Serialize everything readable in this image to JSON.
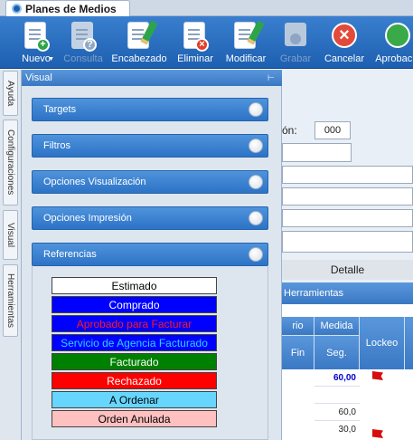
{
  "app_tab": {
    "title": "Planes de Medios"
  },
  "toolbar": {
    "nuevo": "Nuevo",
    "consulta": "Consulta",
    "encabezado": "Encabezado",
    "eliminar": "Eliminar",
    "modificar": "Modificar",
    "grabar": "Grabar",
    "cancelar": "Cancelar",
    "aprobacion": "Aprobació"
  },
  "side_tabs": [
    "Ayuda",
    "Configuraciones",
    "Visual",
    "Herramientas"
  ],
  "panel": {
    "title": "Visual",
    "pin": "⊢",
    "sections": [
      "Targets",
      "Filtros",
      "Opciones Visualización",
      "Opciones Impresión",
      "Referencias"
    ]
  },
  "references": [
    {
      "label": "Estimado",
      "bg": "#ffffff",
      "fg": "#000000"
    },
    {
      "label": "Comprado",
      "bg": "#0000ff",
      "fg": "#ffffff"
    },
    {
      "label": "Aprobado para Facturar",
      "bg": "#0000ff",
      "fg": "#ff1a1a"
    },
    {
      "label": "Servicio de Agencia Facturado",
      "bg": "#0000ff",
      "fg": "#33d1ff"
    },
    {
      "label": "Facturado",
      "bg": "#008000",
      "fg": "#ffffff"
    },
    {
      "label": "Rechazado",
      "bg": "#ff0000",
      "fg": "#ffffff"
    },
    {
      "label": "A Ordenar",
      "bg": "#66d6ff",
      "fg": "#000000"
    },
    {
      "label": "Orden Anulada",
      "bg": "#ffc0c0",
      "fg": "#000000"
    }
  ],
  "background": {
    "field_label": "ón:",
    "field_value": "000",
    "detalle": "Detalle",
    "herramientas": "Herramientas",
    "col_rio": "rio",
    "col_fin": "Fin",
    "col_medida": "Medida",
    "col_seg": "Seg.",
    "col_lockeo": "Lockeo",
    "rows": [
      "60,00",
      "",
      "60,0",
      "30,0"
    ]
  }
}
